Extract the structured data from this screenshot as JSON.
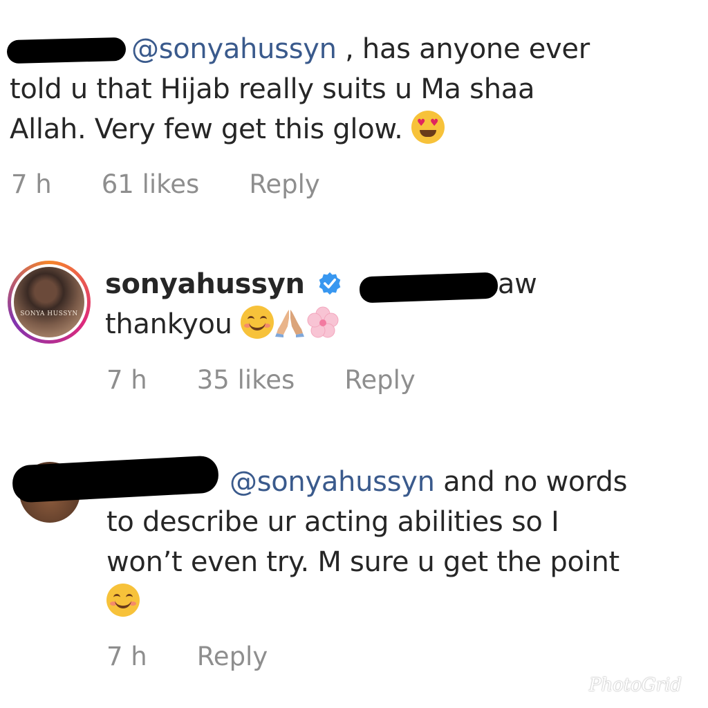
{
  "comments": [
    {
      "mention": "@sonyahussyn",
      "text_after_mention": " , has anyone ever",
      "line2": "told u that Hijab really suits u Ma shaa",
      "line3": "Allah. Very few get this glow.",
      "emoji": "heart-eyes-emoji",
      "time": "7 h",
      "likes": "61 likes",
      "reply_label": "Reply"
    },
    {
      "username": "sonyahussyn",
      "verified": true,
      "text_after_redaction": " aw",
      "line2": "thankyou",
      "emojis": [
        "smiling-blush-emoji",
        "folded-hands-emoji",
        "cherry-blossom-emoji"
      ],
      "avatar_caption": "SONYA HUSSYN",
      "time": "7 h",
      "likes": "35 likes",
      "reply_label": "Reply"
    },
    {
      "mention": "@sonyahussyn",
      "text_after_mention": " and no words",
      "line2": "to describe ur acting abilities so I",
      "line3": "won’t even try. M sure u get the point",
      "emoji": "smiling-blush-emoji",
      "time": "7 h",
      "reply_label": "Reply"
    }
  ],
  "watermark": "PhotoGrid",
  "colors": {
    "text": "#262626",
    "mention": "#3a5a8c",
    "meta": "#8e8e8e",
    "verified": "#3897f0",
    "redaction": "#000000"
  }
}
